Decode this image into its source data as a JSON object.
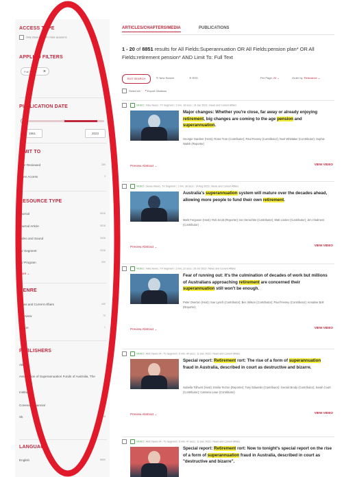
{
  "sidebar": {
    "access_type": {
      "heading": "ACCESS TYPE",
      "option": "Only show content I have access to"
    },
    "applied_filters": {
      "heading": "APPLIED FILTERS",
      "chip": "Full Text"
    },
    "publication_date": {
      "heading": "PUBLICATION DATE",
      "from": "1951",
      "to": "2023",
      "range_fraction": [
        0.44,
        0.88
      ]
    },
    "limit_to": {
      "heading": "LIMIT TO",
      "items": [
        {
          "label": "Peer Reviewed",
          "count": "289"
        },
        {
          "label": "Open Access",
          "count": "3"
        }
      ]
    },
    "resource_type": {
      "heading": "RESOURCE TYPE",
      "items": [
        {
          "label": "Journal",
          "count": "5016"
        },
        {
          "label": "Journal Article",
          "count": "5016"
        },
        {
          "label": "Video and Sound",
          "count": "3426"
        },
        {
          "label": "TV Segment",
          "count": "3226"
        },
        {
          "label": "TV Program",
          "count": "200"
        }
      ],
      "more": "More"
    },
    "genre": {
      "heading": "GENRE",
      "items": [
        {
          "label": "News and Current Affairs",
          "count": "440"
        },
        {
          "label": "Interview",
          "count": "70"
        },
        {
          "label": "Fiction",
          "count": "1"
        }
      ]
    },
    "publishers": {
      "heading": "PUBLISHERS",
      "items": [
        {
          "label": "ABC",
          "count": ""
        },
        {
          "label": "Association of Superannuation Funds of Australia, The",
          "count": ""
        },
        {
          "label": "Institute",
          "count": ""
        },
        {
          "label": "Conexus Financial",
          "count": ""
        },
        {
          "label": "Sk",
          "count": "95"
        }
      ]
    },
    "language": {
      "heading": "LANGUAGE",
      "items": [
        {
          "label": "English",
          "count": "8850"
        }
      ]
    }
  },
  "tabs": {
    "active": "ARTICLES/CHAPTERS/MEDIA",
    "inactive": "PUBLICATIONS"
  },
  "summary": {
    "range": "1 - 20",
    "of": "of",
    "total": "8851",
    "text": "results for All Fields:Superannuation OR All Fields:pension plan* OR All Fields:retirement pension* AND Limit To: Full Text"
  },
  "toolbar": {
    "edit_search": "EDIT SEARCH",
    "new_search": "New Search",
    "rss": "RSS",
    "per_page_label": "Per Page:",
    "per_page_value": "20",
    "order_label": "Order by:",
    "order_value": "Relevance",
    "select_all": "Select All",
    "export": "Export Citations"
  },
  "results": [
    {
      "meta": [
        "VIDEO",
        "Nine News",
        "TV Segment",
        "2 min, 18 secs",
        "14 Jan 2023",
        "News and Current Affairs"
      ],
      "title_parts": [
        {
          "t": "Major changes: Whether you're close, far away or already enjoying ",
          "h": false
        },
        {
          "t": "retirement",
          "h": true
        },
        {
          "t": ", big changes are coming to the age ",
          "h": false
        },
        {
          "t": "pension",
          "h": true
        },
        {
          "t": " and ",
          "h": false
        },
        {
          "t": "superannuation",
          "h": true
        },
        {
          "t": ".",
          "h": false
        }
      ],
      "contributors": "Georgie Gardner (Host); Rosie Tran (Contributor); Paul Feeney (Contributor); Noel Whittaker (Contributor); Sophie Walsh (Reporter)",
      "preview": "Preview Abstract",
      "view": "VIEW VIDEO"
    },
    {
      "meta": [
        "VIDEO",
        "Seven News",
        "TV Segment",
        "1 min, 38 secs",
        "14 Aug 2023",
        "News and Current Affairs"
      ],
      "title_parts": [
        {
          "t": "Australia's ",
          "h": false
        },
        {
          "t": "superannuation",
          "h": true
        },
        {
          "t": " system will mature over the decades ahead, allowing more people to fund their own ",
          "h": false
        },
        {
          "t": "retirement",
          "h": true
        },
        {
          "t": ".",
          "h": false
        }
      ],
      "contributors": "Mark Ferguson (Host); Rob Scott (Reporter); Ian Henschke (Contributor); Matt Linden (Contributor); Jim Chalmers (Contributor)",
      "preview": "Preview Abstract",
      "view": "VIEW VIDEO"
    },
    {
      "meta": [
        "VIDEO",
        "Nine News",
        "TV Segment",
        "2 min, 22 secs",
        "29 Jul 2023",
        "News and Current Affairs"
      ],
      "title_parts": [
        {
          "t": "Fear of running out: It's the culmination of decades of work but millions of Australians approaching ",
          "h": false
        },
        {
          "t": "retirement",
          "h": true
        },
        {
          "t": " are concerned their ",
          "h": false
        },
        {
          "t": "superannuation",
          "h": true
        },
        {
          "t": " still won't be enough.",
          "h": false
        }
      ],
      "contributors": "Peter Overton (Host); Sue Lynch (Contributor); Bec Wilson (Contributor); Paul Feeney (Contributor); Annalise Bolt (Reporter)",
      "preview": "Preview Abstract",
      "view": "VIEW VIDEO"
    },
    {
      "meta": [
        "VIDEO",
        "ABC News 24",
        "TV Segment",
        "5 min, 40 secs",
        "11 Dec 2023",
        "News and Current Affairs"
      ],
      "title_parts": [
        {
          "t": "Special report: ",
          "h": false
        },
        {
          "t": "Retirement",
          "h": true
        },
        {
          "t": " rort: The rise of a form of ",
          "h": false
        },
        {
          "t": "superannuation",
          "h": true
        },
        {
          "t": " fraud in Australia, described in court as destructive and bizarre.",
          "h": false
        }
      ],
      "contributors": "Isabella Tolhurst (Host); Emilia Terzon (Reporter); Tony Edwards (Contributor); Gerard Brody (Contributor); Sarah Court (Contributor); Catriona Lowe (Contributor)",
      "preview": "Preview Abstract",
      "view": "VIEW VIDEO"
    },
    {
      "meta": [
        "VIDEO",
        "ABC News 24",
        "TV Segment",
        "6 min, 47 secs",
        "11 Dec 2023",
        "News and Current Affairs"
      ],
      "title_parts": [
        {
          "t": "Special report: ",
          "h": false
        },
        {
          "t": "Retirement",
          "h": true
        },
        {
          "t": " rort: Now to tonight's special report on the rise of a form of ",
          "h": false
        },
        {
          "t": "superannuation",
          "h": true
        },
        {
          "t": " fraud in Australia, described in court as \"destructive and bizarre\".",
          "h": false
        }
      ],
      "contributors": "",
      "preview": "",
      "view": ""
    }
  ]
}
